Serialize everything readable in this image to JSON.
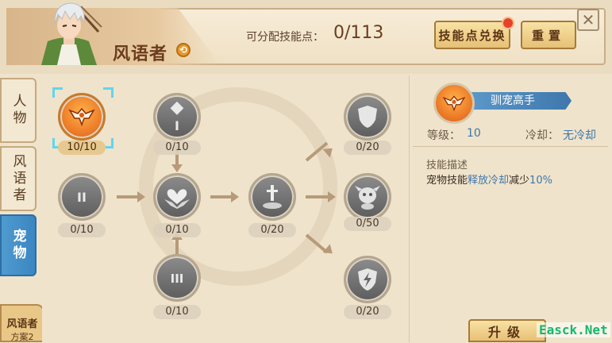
{
  "header": {
    "class_name": "风语者",
    "class_switch_icon": "swap-icon",
    "points_label": "可分配技能点：",
    "points_value": "0/113",
    "exchange_button": "技能点兑换",
    "reset_button": "重置"
  },
  "sidebar": {
    "tabs": [
      {
        "label": "人物",
        "selected": false
      },
      {
        "label": "风语者",
        "selected": false
      },
      {
        "label": "宠物",
        "selected": true
      }
    ],
    "scheme_line1": "风语者",
    "scheme_line2": "方案2"
  },
  "tree": {
    "nodes": [
      {
        "id": "tamer",
        "icon": "eagle-crest-icon",
        "label": "10/10",
        "active": true,
        "selected": true
      },
      {
        "id": "tier1",
        "icon": "roman-one-icon",
        "glyph": "I",
        "label": "0/10"
      },
      {
        "id": "tier2",
        "icon": "roman-two-icon",
        "glyph": "II",
        "label": "0/10"
      },
      {
        "id": "heart",
        "icon": "heart-wings-icon",
        "label": "0/10"
      },
      {
        "id": "tier3",
        "icon": "roman-three-icon",
        "glyph": "III",
        "label": "0/10"
      },
      {
        "id": "sword",
        "icon": "sword-stone-icon",
        "label": "0/20"
      },
      {
        "id": "shield",
        "icon": "shield-icon",
        "label": "0/20"
      },
      {
        "id": "pet",
        "icon": "pet-creature-icon",
        "label": "0/50"
      },
      {
        "id": "lightning",
        "icon": "lightning-shield-icon",
        "label": "0/20"
      }
    ]
  },
  "detail": {
    "skill_name": "驯宠高手",
    "level_label": "等级：",
    "level_value": "10",
    "cd_label": "冷却：",
    "cd_value": "无冷却",
    "desc_title": "技能描述",
    "desc_part1": "宠物技能",
    "desc_highlight": "释放冷却",
    "desc_part2": "减少",
    "desc_value": "10%",
    "upgrade_button": "升级"
  },
  "watermark": "Easck.Net",
  "colors": {
    "accent_blue": "#3e77ac",
    "active_orange": "#e05a12",
    "selection_cyan": "#5fd6f0"
  }
}
